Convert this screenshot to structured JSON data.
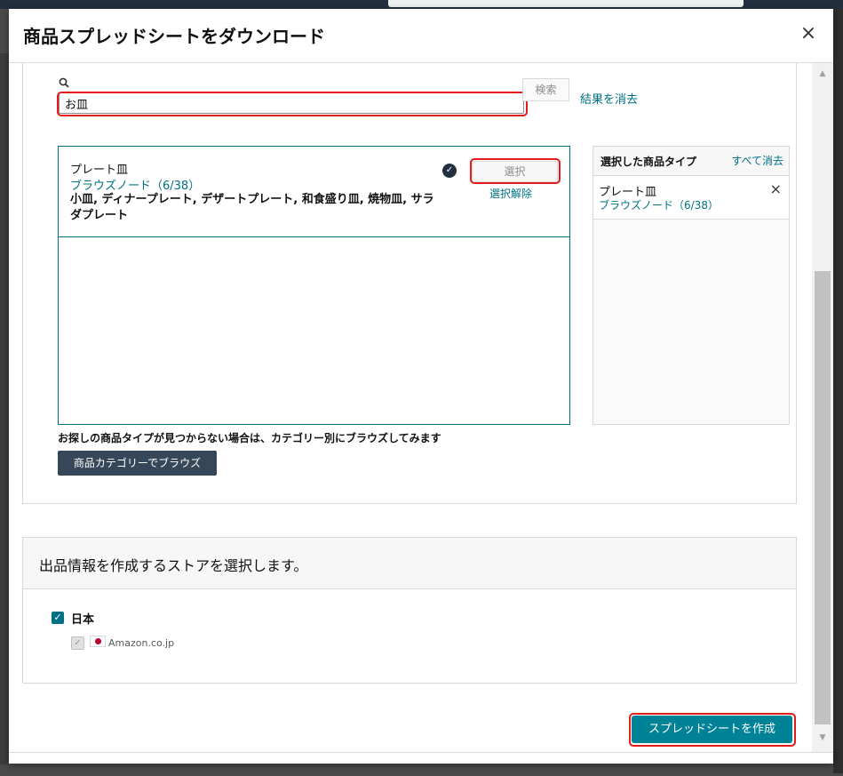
{
  "dialog": {
    "title": "商品スプレッドシートをダウンロード",
    "close_label": "×"
  },
  "search": {
    "value": "お皿",
    "button_label": "検索",
    "clear_label": "結果を消去"
  },
  "result": {
    "name": "プレート皿",
    "browse_link": "ブラウズノード（6/38）",
    "description": "小皿, ディナープレート, デザートプレート, 和食盛り皿, 焼物皿, サラダプレート",
    "select_label": "選択",
    "deselect_label": "選択解除"
  },
  "selected": {
    "header": "選択した商品タイプ",
    "clear_all": "すべて消去",
    "item_name": "プレート皿",
    "item_link": "ブラウズノード（6/38）",
    "remove_label": "×"
  },
  "hint": {
    "text": "お探しの商品タイプが見つからない場合は、カテゴリー別にブラウズしてみます",
    "browse_button": "商品カテゴリーでブラウズ"
  },
  "store": {
    "title": "出品情報を作成するストアを選択します。",
    "country": "日本",
    "marketplace": "Amazon.co.jp"
  },
  "actions": {
    "create_label": "スプレッドシートを作成"
  },
  "colors": {
    "link": "#007185",
    "primary_button": "#008296",
    "dark_button": "#37475a",
    "highlight": "#e31b1b"
  }
}
